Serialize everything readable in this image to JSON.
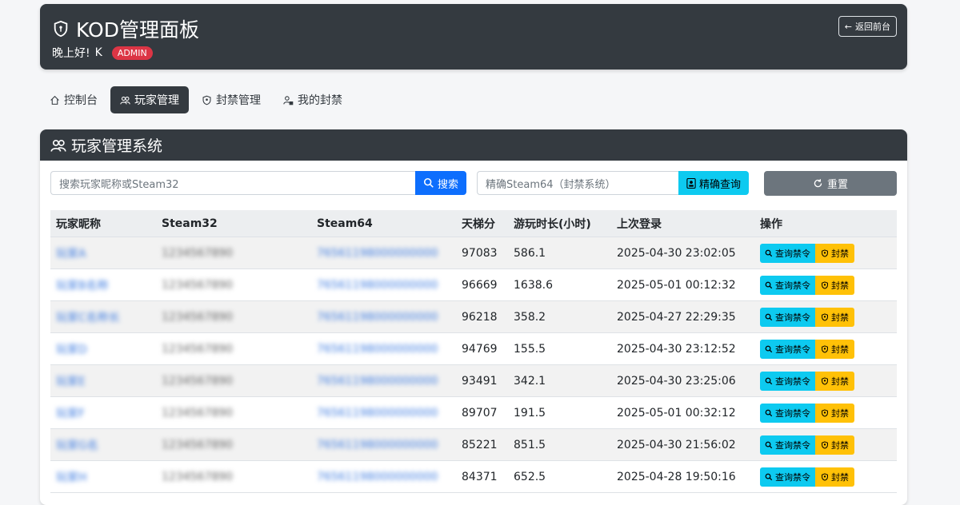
{
  "header": {
    "title": "KOD管理面板",
    "greeting": "晚上好!",
    "username": "K",
    "role_badge": "ADMIN",
    "back_button": "返回前台"
  },
  "nav": {
    "tabs": [
      {
        "label": "控制台",
        "icon": "home-icon"
      },
      {
        "label": "玩家管理",
        "icon": "users-icon",
        "active": true
      },
      {
        "label": "封禁管理",
        "icon": "shield-icon"
      },
      {
        "label": "我的封禁",
        "icon": "user-lock-icon"
      }
    ]
  },
  "panel": {
    "title": "玩家管理系统",
    "search": {
      "placeholder": "搜索玩家昵称或Steam32",
      "button": "搜索"
    },
    "exact": {
      "placeholder": "精确Steam64（封禁系统）",
      "button": "精确查询"
    },
    "reset_button": "重置"
  },
  "table": {
    "columns": [
      "玩家昵称",
      "Steam32",
      "Steam64",
      "天梯分",
      "游玩时长(小时)",
      "上次登录",
      "操作"
    ],
    "rows": [
      {
        "name": "玩家A",
        "steam32": "1234567890",
        "steam64": "76561198000000000",
        "score": "97083",
        "hours": "586.1",
        "last": "2025-04-30 23:02:05"
      },
      {
        "name": "玩家B名称",
        "steam32": "1234567890",
        "steam64": "76561198000000000",
        "score": "96669",
        "hours": "1638.6",
        "last": "2025-05-01 00:12:32"
      },
      {
        "name": "玩家C名称长",
        "steam32": "1234567890",
        "steam64": "76561198000000000",
        "score": "96218",
        "hours": "358.2",
        "last": "2025-04-27 22:29:35"
      },
      {
        "name": "玩家D",
        "steam32": "1234567890",
        "steam64": "76561198000000000",
        "score": "94769",
        "hours": "155.5",
        "last": "2025-04-30 23:12:52"
      },
      {
        "name": "玩家E",
        "steam32": "1234567890",
        "steam64": "76561198000000000",
        "score": "93491",
        "hours": "342.1",
        "last": "2025-04-30 23:25:06"
      },
      {
        "name": "玩家F",
        "steam32": "1234567890",
        "steam64": "76561198000000000",
        "score": "89707",
        "hours": "191.5",
        "last": "2025-05-01 00:32:12"
      },
      {
        "name": "玩家G名",
        "steam32": "1234567890",
        "steam64": "76561198000000000",
        "score": "85221",
        "hours": "851.5",
        "last": "2025-04-30 21:56:02"
      },
      {
        "name": "玩家H",
        "steam32": "1234567890",
        "steam64": "76561198000000000",
        "score": "84371",
        "hours": "652.5",
        "last": "2025-04-28 19:50:16"
      }
    ],
    "action_query": "查询禁令",
    "action_ban": "封禁"
  },
  "colors": {
    "dark": "#343a40",
    "primary": "#0d6efd",
    "info": "#0dcaf0",
    "warning": "#ffc107",
    "danger": "#dc3545",
    "secondary": "#6c757d"
  }
}
